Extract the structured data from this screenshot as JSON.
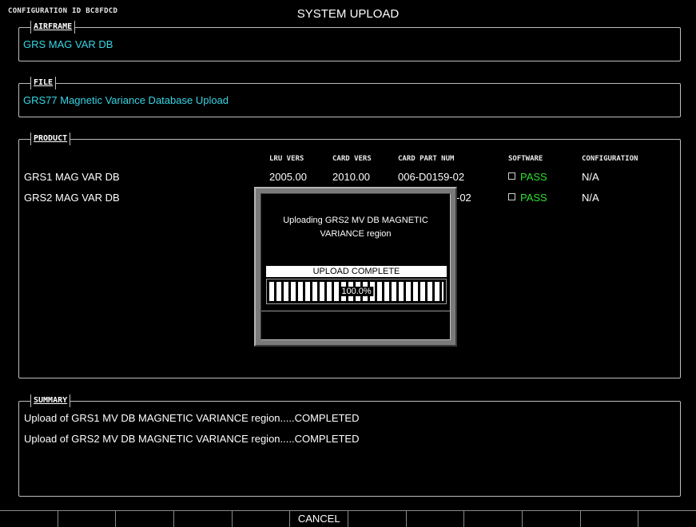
{
  "header": {
    "config_id": "CONFIGURATION ID BC8FDCD",
    "title": "SYSTEM UPLOAD"
  },
  "airframe": {
    "legend": "AIRFRAME",
    "value": "GRS MAG VAR DB"
  },
  "file": {
    "legend": "FILE",
    "value": "GRS77 Magnetic Variance Database Upload"
  },
  "product": {
    "legend": "PRODUCT",
    "columns": {
      "lru_vers": "LRU VERS",
      "card_vers": "CARD VERS",
      "card_part_num": "CARD PART NUM",
      "software": "SOFTWARE",
      "configuration": "CONFIGURATION"
    },
    "rows": [
      {
        "name": "GRS1 MAG VAR DB",
        "lru_vers": "2005.00",
        "card_vers": "2010.00",
        "card_part_num": "006-D0159-02",
        "software": "PASS",
        "configuration": "N/A"
      },
      {
        "name": "GRS2 MAG VAR DB",
        "lru_vers": "",
        "card_vers": "",
        "card_part_num": "-02",
        "software": "PASS",
        "configuration": "N/A"
      }
    ]
  },
  "popup": {
    "message_line1": "Uploading GRS2 MV DB MAGNETIC",
    "message_line2": "VARIANCE region",
    "status": "UPLOAD COMPLETE",
    "percent_label": "100.0%",
    "progress": 1.0
  },
  "summary": {
    "legend": "SUMMARY",
    "lines": [
      "Upload of GRS1 MV DB MAGNETIC VARIANCE region.....COMPLETED",
      "Upload of GRS2 MV DB MAGNETIC VARIANCE region.....COMPLETED"
    ]
  },
  "softkeys": [
    "",
    "",
    "",
    "",
    "",
    "CANCEL",
    "",
    "",
    "",
    "",
    "",
    ""
  ],
  "colors": {
    "cyan": "#36d6e6",
    "pass_green": "#2fe02f"
  }
}
